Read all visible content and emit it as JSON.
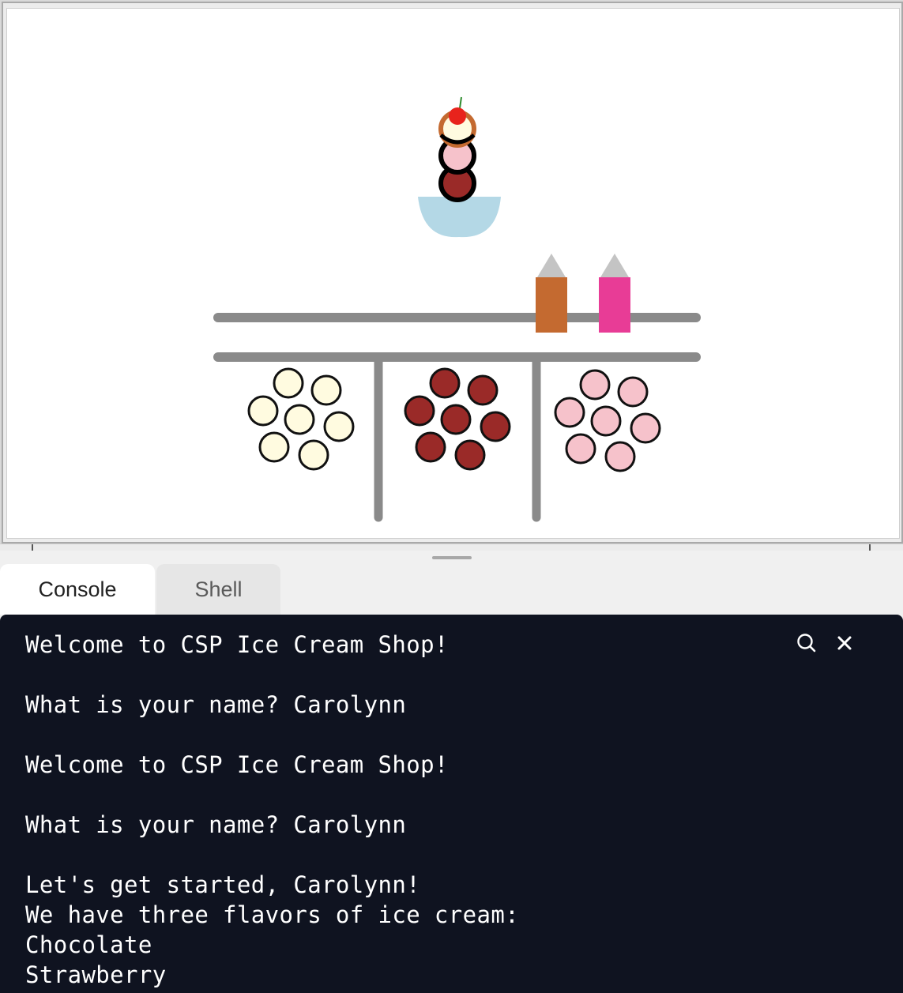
{
  "tabs": [
    {
      "label": "Console",
      "active": true
    },
    {
      "label": "Shell",
      "active": false
    }
  ],
  "console": {
    "lines": [
      "Welcome to CSP Ice Cream Shop!",
      "",
      "What is your name? Carolynn",
      "",
      "Welcome to CSP Ice Cream Shop!",
      "",
      "What is your name? Carolynn",
      "",
      "Let's get started, Carolynn!",
      "We have three flavors of ice cream:",
      "Chocolate",
      "Strawberry"
    ],
    "tool_icons": [
      "search-icon",
      "close-icon"
    ]
  },
  "scene": {
    "flavor_colors": {
      "vanilla": "#fffbe0",
      "chocolate": "#9a2a28",
      "strawberry": "#f6c2cb"
    },
    "bowl_color": "#b4d8e6",
    "cherry_color": "#e8231c",
    "shelf_color": "#8a8a8a",
    "sauce_bottles": [
      {
        "name": "caramel",
        "color": "#c46a30"
      },
      {
        "name": "raspberry",
        "color": "#e83c96"
      }
    ],
    "scoop_stack": [
      "chocolate",
      "strawberry",
      "vanilla"
    ],
    "tub_order": [
      "vanilla",
      "chocolate",
      "strawberry"
    ]
  },
  "colors": {
    "console_bg": "#0f1320",
    "console_text": "#ffffff",
    "canvas_bg": "#ffffff"
  }
}
